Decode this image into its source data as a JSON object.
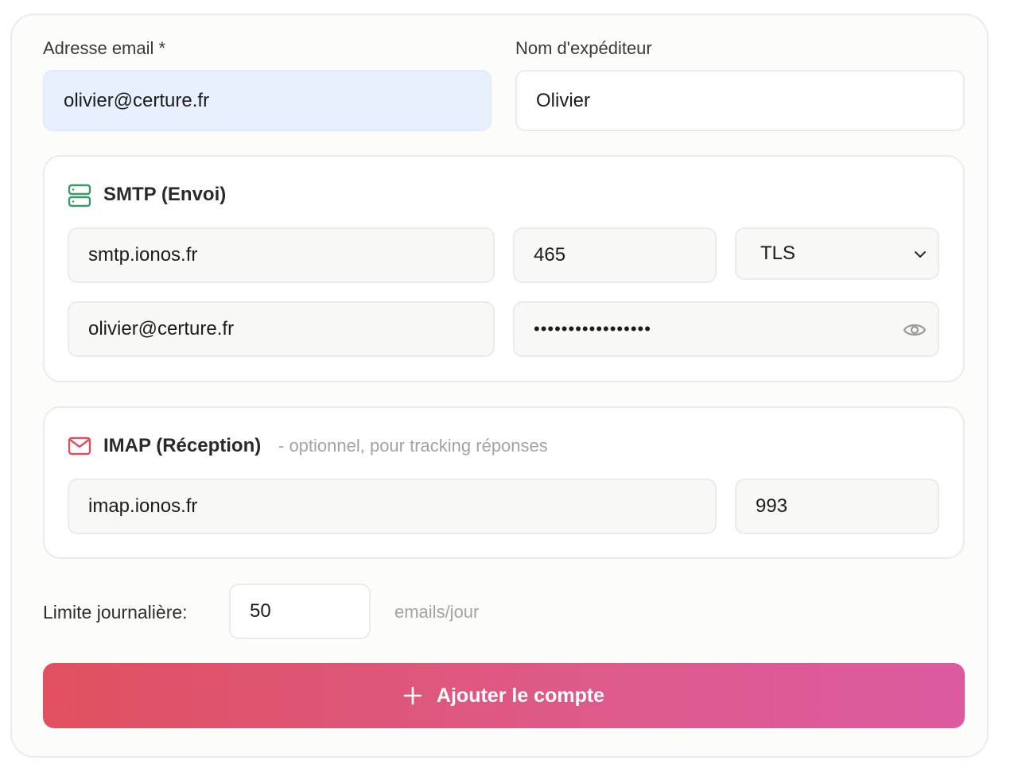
{
  "account": {
    "email_label": "Adresse email *",
    "email_value": "olivier@certure.fr",
    "sender_label": "Nom d'expéditeur",
    "sender_value": "Olivier"
  },
  "smtp": {
    "title": "SMTP (Envoi)",
    "icon": "server-icon",
    "host": "smtp.ionos.fr",
    "port": "465",
    "security": "TLS",
    "username": "olivier@certure.fr",
    "password_mask": "•••••••••••••••••"
  },
  "imap": {
    "title": "IMAP (Réception)",
    "subtitle": "- optionnel, pour tracking réponses",
    "icon": "mail-icon",
    "host": "imap.ionos.fr",
    "port": "993"
  },
  "limit": {
    "label": "Limite journalière:",
    "value": "50",
    "unit": "emails/jour"
  },
  "submit": {
    "label": "Ajouter le compte",
    "icon": "plus-icon"
  },
  "colors": {
    "accent_start": "#e0505f",
    "accent_end": "#dc5ba0",
    "smtp_icon": "#3a9a6a",
    "imap_icon": "#e0505f",
    "focus_field": "#e9f0fd"
  }
}
